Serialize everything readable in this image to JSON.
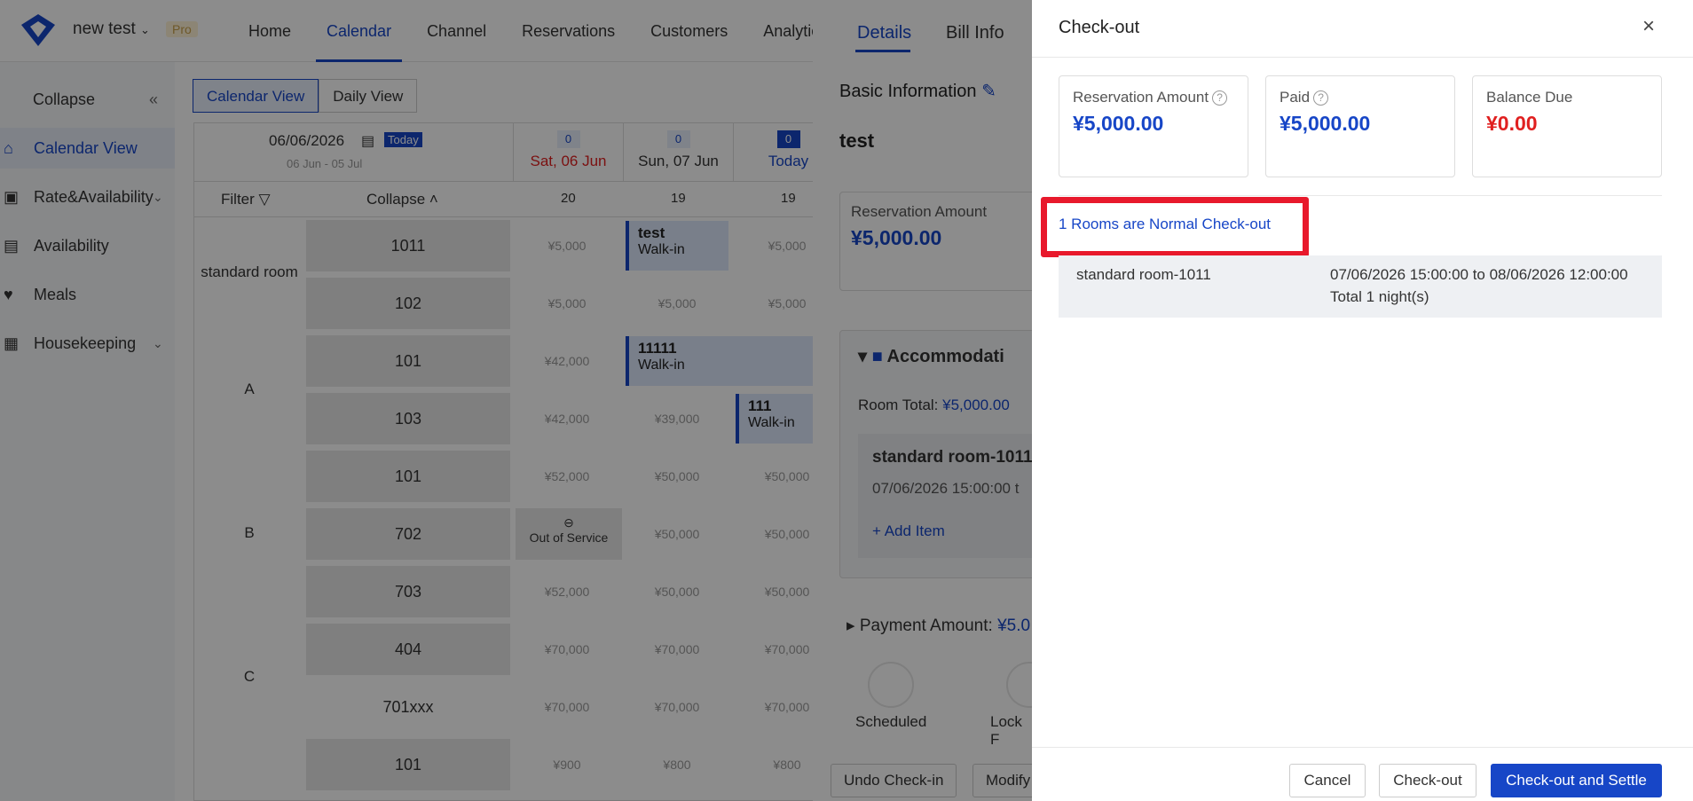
{
  "topbar": {
    "hotel_name": "new test",
    "pro_badge": "Pro",
    "nav": [
      "Home",
      "Calendar",
      "Channel",
      "Reservations",
      "Customers",
      "Analytics"
    ],
    "active_nav": "Calendar"
  },
  "sidebar": {
    "collapse_label": "Collapse",
    "items": [
      {
        "label": "Calendar View"
      },
      {
        "label": "Rate&Availability"
      },
      {
        "label": "Availability"
      },
      {
        "label": "Meals"
      },
      {
        "label": "Housekeeping"
      }
    ]
  },
  "calendar": {
    "view_tabs": [
      "Calendar View",
      "Daily View"
    ],
    "date": "06/06/2026",
    "today_badge": "Today",
    "range": "06 Jun - 05 Jul",
    "filter_label": "Filter",
    "collapse_label": "Collapse",
    "columns": [
      {
        "count": "0",
        "label": "Sat, 06 Jun",
        "avail": "20"
      },
      {
        "count": "0",
        "label": "Sun, 07 Jun",
        "avail": "19"
      },
      {
        "count": "0",
        "label": "Today",
        "avail": "19"
      }
    ],
    "room_types": [
      "standard room",
      "A",
      "B",
      "C"
    ],
    "rooms": [
      "1011",
      "102",
      "101",
      "103",
      "101",
      "702",
      "703",
      "404",
      "701xxx",
      "101"
    ],
    "prices": [
      [
        "¥5,000",
        "",
        "¥5,000"
      ],
      [
        "¥5,000",
        "¥5,000",
        "¥5,000"
      ],
      [
        "¥42,000",
        "",
        ""
      ],
      [
        "¥42,000",
        "¥39,000",
        ""
      ],
      [
        "¥52,000",
        "¥50,000",
        "¥50,000"
      ],
      [
        "",
        "¥50,000",
        "¥50,000"
      ],
      [
        "¥52,000",
        "¥50,000",
        "¥50,000"
      ],
      [
        "¥70,000",
        "¥70,000",
        "¥70,000"
      ],
      [
        "¥70,000",
        "¥70,000",
        "¥70,000"
      ],
      [
        "¥900",
        "¥800",
        "¥800"
      ]
    ],
    "bookings": [
      {
        "name": "test",
        "source": "Walk-in"
      },
      {
        "name": "11111",
        "source": "Walk-in"
      },
      {
        "name": "111",
        "source": "Walk-in"
      }
    ],
    "out_of_service": "Out of Service"
  },
  "details": {
    "tabs": [
      "Details",
      "Bill Info"
    ],
    "basic_info": "Basic Information",
    "guest": "test",
    "res_amount_label": "Reservation Amount",
    "res_amount": "¥5,000.00",
    "accommodation": "Accommodati",
    "room_total_label": "Room Total:",
    "room_total": "¥5,000.00",
    "room_name": "standard room-1011",
    "room_dates": "07/06/2026 15:00:00 t",
    "add_item": "Add Item",
    "payment_label": "Payment Amount:",
    "payment_value": "¥5.0",
    "actions": [
      "Scheduled",
      "Lock F"
    ],
    "footer_buttons": [
      "Undo Check-in",
      "Modify"
    ]
  },
  "modal": {
    "title": "Check-out",
    "cards": [
      {
        "label": "Reservation Amount",
        "value": "¥5,000.00",
        "help": true
      },
      {
        "label": "Paid",
        "value": "¥5,000.00",
        "help": true
      },
      {
        "label": "Balance Due",
        "value": "¥0.00",
        "help": false
      }
    ],
    "normal_checkout": "1 Rooms are Normal Check-out",
    "room": {
      "name": "standard room-1011",
      "dates": "07/06/2026 15:00:00 to 08/06/2026 12:00:00",
      "nights": "Total 1 night(s)"
    },
    "buttons": {
      "cancel": "Cancel",
      "checkout": "Check-out",
      "checkout_settle": "Check-out and Settle"
    }
  },
  "colors": {
    "accent": "#1746c7",
    "balance": "#e02020",
    "highlight_box": "#e8192c"
  }
}
